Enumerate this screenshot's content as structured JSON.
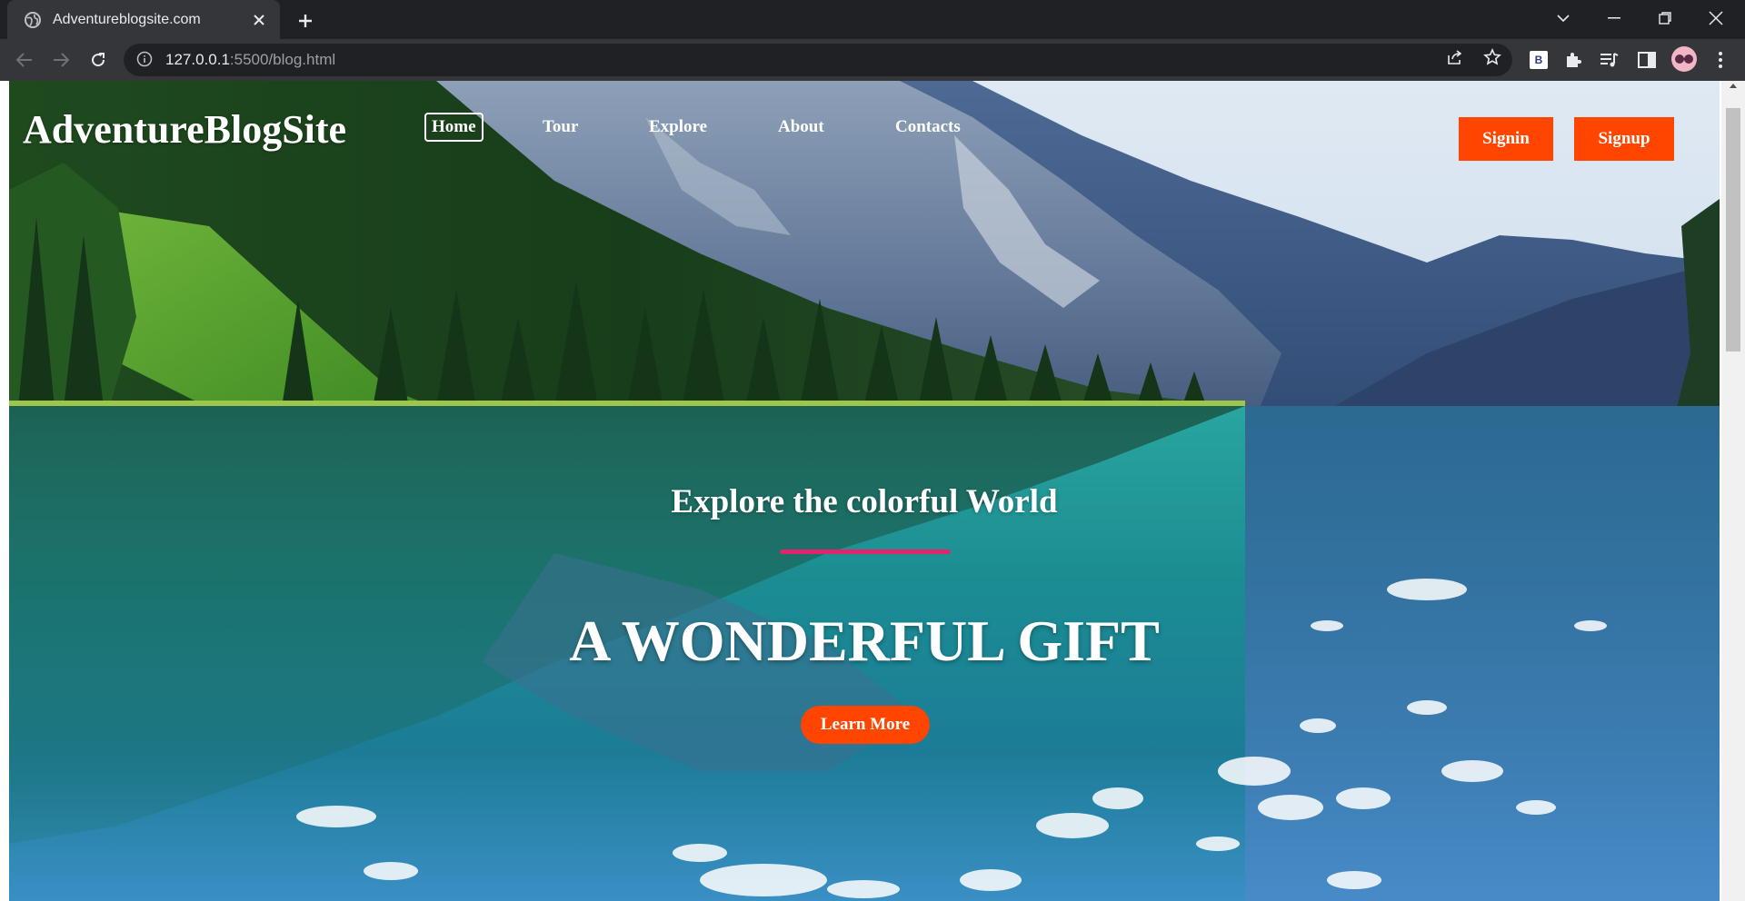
{
  "browser": {
    "tab_title": "Adventureblogsite.com",
    "url_host": "127.0.0.1",
    "url_rest": ":5500/blog.html",
    "extension_b_label": "B"
  },
  "site": {
    "logo": "AdventureBlogSite",
    "nav": [
      {
        "label": "Home",
        "active": true
      },
      {
        "label": "Tour"
      },
      {
        "label": "Explore"
      },
      {
        "label": "About"
      },
      {
        "label": "Contacts"
      }
    ],
    "signin_label": "Signin",
    "signup_label": "Signup",
    "hero_subtitle": "Explore the colorful World",
    "hero_title": "A WONDERFUL GIFT",
    "cta_label": "Learn More"
  },
  "colors": {
    "accent_button": "#ff4500",
    "divider": "#e2246f",
    "chrome_dark": "#202124",
    "chrome_toolbar": "#35363a"
  },
  "icons": [
    "globe-icon",
    "close-icon",
    "plus-icon",
    "chevron-down-icon",
    "minimize-icon",
    "restore-icon",
    "window-close-icon",
    "back-arrow-icon",
    "forward-arrow-icon",
    "reload-icon",
    "info-icon",
    "share-icon",
    "star-icon",
    "puzzle-icon",
    "media-icon",
    "sidebar-icon",
    "avatar",
    "menu-dots-icon"
  ]
}
